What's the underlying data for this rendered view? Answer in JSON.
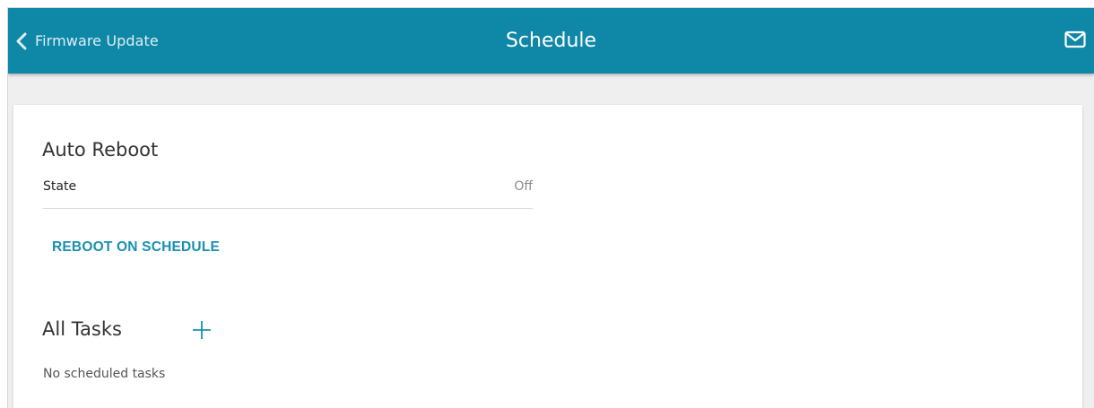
{
  "header": {
    "back_label": "Firmware Update",
    "title": "Schedule",
    "back_icon": "chevron-left-icon",
    "mail_icon": "envelope-icon",
    "bar_color": "#0f87a7"
  },
  "auto_reboot": {
    "title": "Auto Reboot",
    "state_label": "State",
    "state_value": "Off",
    "schedule_button": "REBOOT ON SCHEDULE"
  },
  "tasks": {
    "title": "All Tasks",
    "add_icon": "plus-icon",
    "empty_text": "No scheduled tasks"
  },
  "colors": {
    "accent": "#1a8fb0"
  }
}
